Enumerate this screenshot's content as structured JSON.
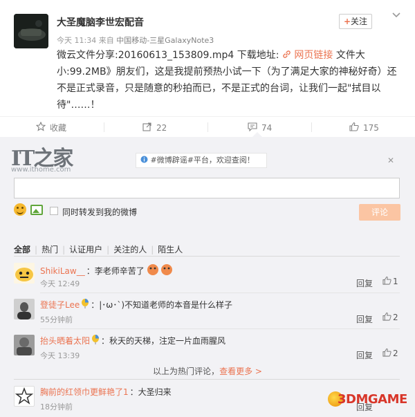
{
  "post": {
    "username": "大圣魔脑李世宏配音",
    "time": "今天 11:34",
    "source_prefix": "来自",
    "source": "中国移动-三星GalaxyNote3",
    "follow_label": "关注",
    "text_part1": "微云文件分享:20160613_153809.mp4 下载地址:",
    "link_label": "网页链接",
    "text_part2": " 文件大小:99.2MB》朋友们，这是我提前预热小试一下（为了满足大家的神秘好奇）还不是正式录音，只是随意的秒拍而已，不是正式的台词，让我们一起\"拭目以待\"……！"
  },
  "actions": {
    "favorite_label": "收藏",
    "repost_count": "22",
    "comment_count": "74",
    "like_count": "175"
  },
  "watermark": {
    "logo": "IT之家",
    "url": "www.ithome.com"
  },
  "comment_box": {
    "notice": "#微博辟谣#平台，欢迎查阅！",
    "input_value": "",
    "repost_label": "同时转发到我的微博",
    "submit_label": "评论"
  },
  "filters": {
    "items": [
      "全部",
      "热门",
      "认证用户",
      "关注的人",
      "陌生人"
    ]
  },
  "comments": [
    {
      "name": "ShikiLaw__",
      "text": "：李老师辛苦了",
      "time": "今天 12:49",
      "reply": "回复",
      "likes": "1"
    },
    {
      "name": "登徒子Lee",
      "text": "：|･ω･`)不知道老师的本音是什么样子",
      "time": "55分钟前",
      "reply": "回复",
      "likes": "2"
    },
    {
      "name": "抬头晒着太阳",
      "text": "：秋天的天梯，注定一片血雨腥风",
      "time": "今天 13:39",
      "reply": "回复",
      "likes": "2"
    },
    {
      "name": "胸前的红领巾更鲜艳了1",
      "text": "：大圣归来",
      "time": "18分钟前",
      "reply": "回复",
      "likes": ""
    }
  ],
  "more_comments": {
    "prefix": "以上为热门评论，",
    "link": "查看更多"
  },
  "brand": {
    "part1": "3DM",
    "part2": "GAME"
  },
  "colors": {
    "accent": "#eb7350",
    "background": "#f2f2f5"
  }
}
